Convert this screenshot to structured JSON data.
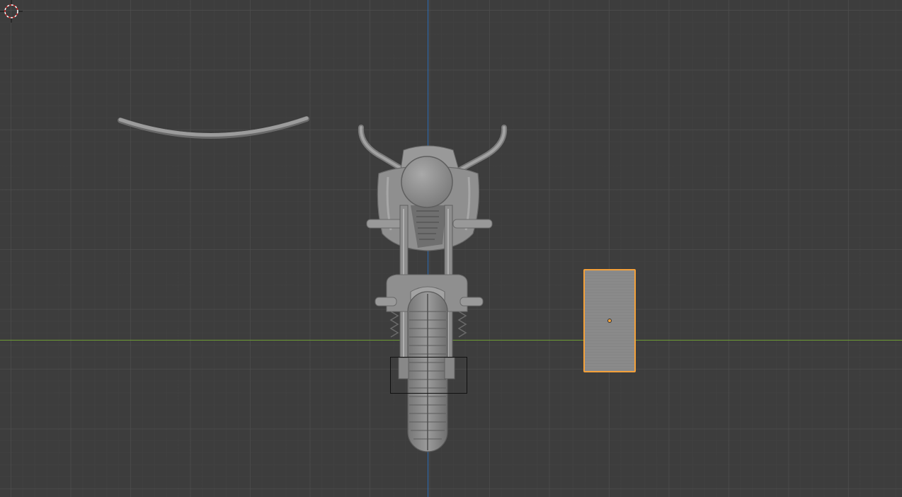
{
  "viewport": {
    "background_color": "#3d3d3d",
    "grid_color": "#505050",
    "axis_x_color": "#6d9a35",
    "axis_y_color": "#2b6cb4",
    "selection_color": "#f4a13a"
  },
  "scene": {
    "objects": [
      {
        "name": "curve-tube",
        "selected": false
      },
      {
        "name": "motorcycle-mesh",
        "selected": false
      },
      {
        "name": "plane-mesh",
        "selected": true
      },
      {
        "name": "empty-object",
        "selected": false
      }
    ],
    "cursor": {
      "icon": "3d-cursor-icon"
    }
  }
}
